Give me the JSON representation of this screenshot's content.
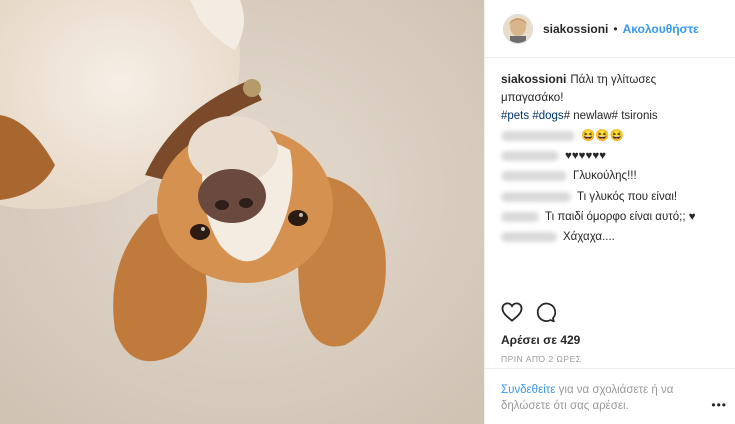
{
  "photo": {
    "description_icon": "beagle-photo"
  },
  "header": {
    "username": "siakossioni",
    "separator": "•",
    "follow_label": "Ακολουθήστε"
  },
  "caption": {
    "username": "siakossioni",
    "text": "Πάλι τη γλίτωσες μπαγασάκο!",
    "tag_pets": "#pets",
    "tag_dogs": "#dogs",
    "tail": "# newlaw# tsironis"
  },
  "comments": [
    {
      "blurred_user": "georgiosyama",
      "text": "😆😆😆"
    },
    {
      "blurred_user": "yannis_andreou",
      "text": "♥♥♥♥♥♥"
    },
    {
      "blurred_user": "antonioupetra",
      "text": "Γλυκούλης!!!"
    },
    {
      "blurred_user": "mariladivanou",
      "text": "Τι γλυκός που είναι!"
    },
    {
      "blurred_user": "elenikote",
      "text": "Τι παιδί όμορφο είναι αυτό;; ♥"
    },
    {
      "blurred_user": "1georgiou75",
      "text": "Χάχαχα...."
    }
  ],
  "actions": {
    "like_icon": "heart-icon",
    "comment_icon": "comment-icon"
  },
  "likes_text": "Αρέσει σε 429",
  "time_text": "ΠΡΙΝ ΑΠΌ 2 ΩΡΕΣ",
  "footer": {
    "login_label": "Συνδεθείτε",
    "rest": " για να σχολιάσετε ή να δηλώσετε ότι σας αρέσει."
  },
  "more_label": "•••"
}
